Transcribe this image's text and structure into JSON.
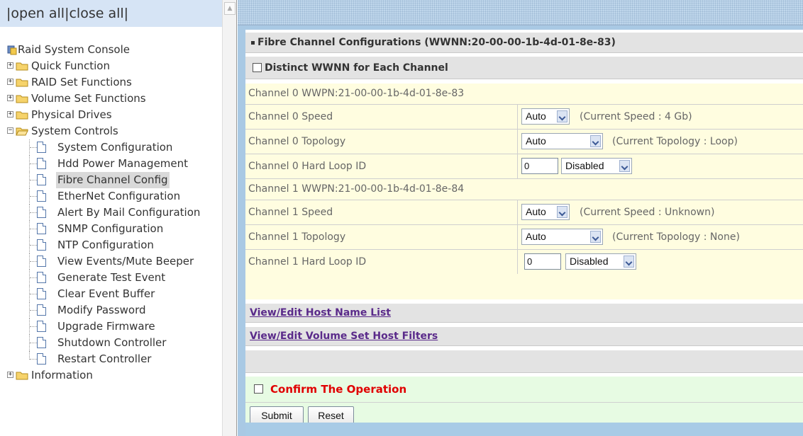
{
  "left_pane": {
    "open_close": [
      "|open all",
      "|close all|"
    ],
    "root_label": "Raid System Console",
    "folders": [
      {
        "label": "Quick Function",
        "expanded": false
      },
      {
        "label": "RAID Set Functions",
        "expanded": false
      },
      {
        "label": "Volume Set Functions",
        "expanded": false
      },
      {
        "label": "Physical Drives",
        "expanded": false
      },
      {
        "label": "System Controls",
        "expanded": true
      },
      {
        "label": "Information",
        "expanded": false
      }
    ],
    "system_controls_items": [
      "System Configuration",
      "Hdd Power Management",
      "Fibre Channel Config",
      "EtherNet Configuration",
      "Alert By Mail Configuration",
      "SNMP Configuration",
      "NTP Configuration",
      "View Events/Mute Beeper",
      "Generate Test Event",
      "Clear Event Buffer",
      "Modify Password",
      "Upgrade Firmware",
      "Shutdown Controller",
      "Restart Controller"
    ],
    "selected_item": "Fibre Channel Config"
  },
  "main": {
    "title": "Fibre Channel Configurations (WWNN:20-00-00-1b-4d-01-8e-83)",
    "distinct_wwnn_label": "Distinct WWNN for Each Channel",
    "channel0": {
      "wwpn": "Channel 0 WWPN:21-00-00-1b-4d-01-8e-83",
      "speed_label": "Channel 0 Speed",
      "speed_value": "Auto",
      "speed_hint": "(Current Speed : 4 Gb)",
      "topology_label": "Channel 0 Topology",
      "topology_value": "Auto",
      "topology_hint": "(Current Topology : Loop)",
      "loop_label": "Channel 0 Hard Loop ID",
      "loop_id_value": "0",
      "loop_state": "Disabled"
    },
    "channel1": {
      "wwpn": "Channel 1 WWPN:21-00-00-1b-4d-01-8e-84",
      "speed_label": "Channel 1 Speed",
      "speed_value": "Auto",
      "speed_hint": "(Current Speed : Unknown)",
      "topology_label": "Channel 1 Topology",
      "topology_value": "Auto",
      "topology_hint": "(Current Topology : None)",
      "loop_label": "Channel 1 Hard Loop ID",
      "loop_id_value": "0",
      "loop_state": "Disabled"
    },
    "links": {
      "host_name_list": "View/Edit Host Name List",
      "volume_host_filters": "View/Edit Volume Set Host Filters"
    },
    "confirm_label": "Confirm The Operation",
    "submit_label": "Submit",
    "reset_label": "Reset"
  },
  "colors": {
    "confirm_text": "#e00000",
    "config_bg": "#fffde0",
    "confirm_bg": "#e7fbe3",
    "frame_blue": "#a9c9e4",
    "link": "#5a2a8a"
  }
}
